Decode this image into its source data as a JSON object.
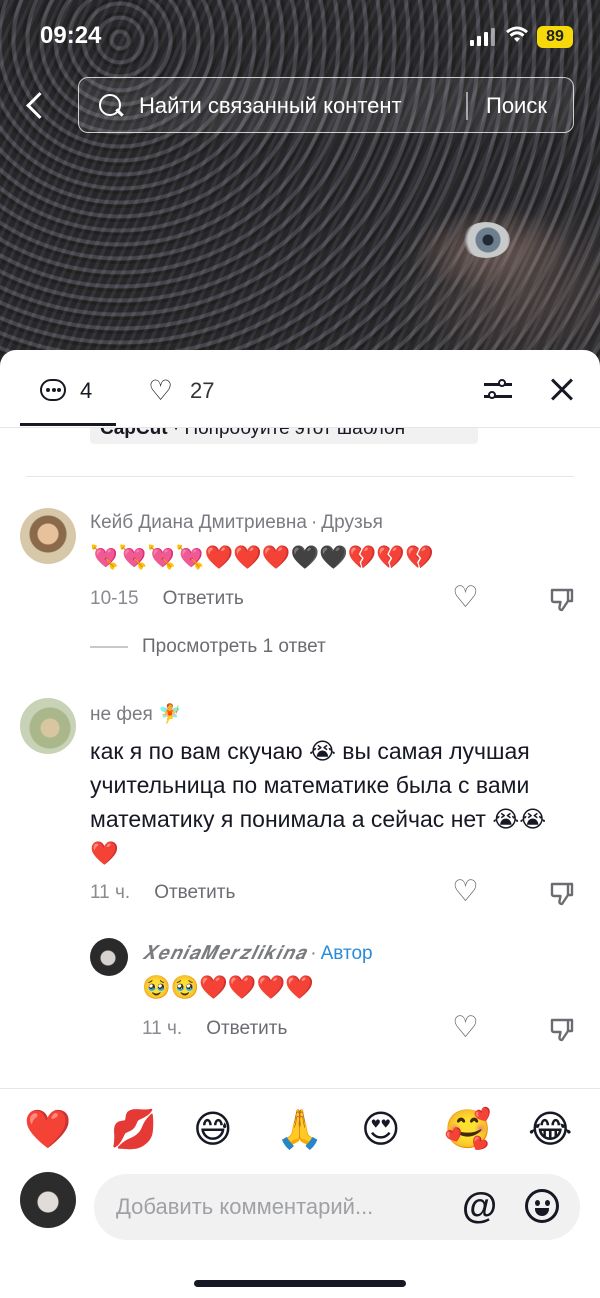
{
  "status": {
    "time": "09:24",
    "battery": "89"
  },
  "search": {
    "placeholder": "Найти связанный контент",
    "button": "Поиск"
  },
  "tabs": {
    "comments_count": "4",
    "likes_count": "27"
  },
  "partial_banner": {
    "brand": "CapCut",
    "text": "· Попробуйте этот шаблон"
  },
  "comments": [
    {
      "author": "Кейб Диана Дмитриевна",
      "relation": "Друзья",
      "text": "💘💘💘💘❤️❤️❤️🖤🖤💔💔💔",
      "time": "10-15",
      "reply_label": "Ответить",
      "view_replies": "Просмотреть 1 ответ"
    },
    {
      "author": "не фея",
      "author_emoji": "🧚",
      "text": "как я по вам скучаю 😭 вы самая лучшая учительница по математике была с вами математику я понимала а сейчас нет 😭😭❤️",
      "time": "11 ч.",
      "reply_label": "Ответить",
      "reply": {
        "author": "𝑿𝒆𝒏𝒊𝒂𝑴𝒆𝒓𝒛𝒍𝒊𝒌𝒊𝒏𝒂",
        "tag": "Автор",
        "text": "🥹🥹❤️❤️❤️❤️",
        "time": "11 ч.",
        "reply_label": "Ответить"
      }
    }
  ],
  "reactions": [
    "❤️",
    "💋",
    "😅",
    "🙏",
    "😍",
    "🥰",
    "😂"
  ],
  "input": {
    "placeholder": "Добавить комментарий...",
    "at_symbol": "@"
  },
  "icons": [
    "back-icon",
    "search-icon",
    "comment-icon",
    "heart-icon",
    "filter-icon",
    "close-icon",
    "dislike-icon",
    "emoji-icon"
  ]
}
